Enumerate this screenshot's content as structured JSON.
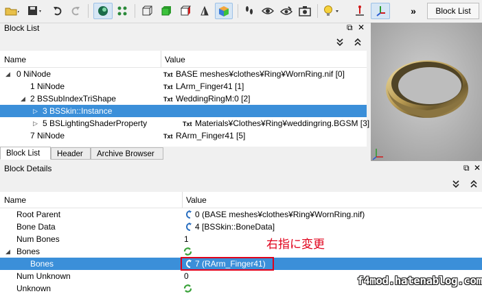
{
  "toolbar": {
    "blocklist_button": "Block List",
    "more_glyph": "»",
    "icons": [
      "open-folder-icon",
      "save-icon",
      "undo-icon",
      "redo-icon",
      "sphere-icon",
      "nodes-icon",
      "wireframe-cube-icon",
      "solid-cube-icon",
      "textured-cube-icon",
      "normals-icon",
      "colored-cube-icon",
      "footprints-icon",
      "eye-icon",
      "eye-dropper-icon",
      "camera-icon",
      "light-bulb-icon",
      "axes-icon",
      "axes-active-icon"
    ]
  },
  "block_list": {
    "title": "Block List",
    "columns": {
      "name": "Name",
      "value": "Value"
    },
    "rows": [
      {
        "name": "0 NiNode",
        "value": "BASE meshes¥clothes¥Ring¥WornRing.nif [0]",
        "txt": "Txt",
        "expander": "◢"
      },
      {
        "name": "1 NiNode",
        "value": "LArm_Finger41 [1]",
        "txt": "Txt",
        "expander": ""
      },
      {
        "name": "2 BSSubIndexTriShape",
        "value": "WeddingRingM:0 [2]",
        "txt": "Txt",
        "expander": "◢"
      },
      {
        "name": "3 BSSkin::Instance",
        "value": "",
        "txt": "",
        "expander": "▷"
      },
      {
        "name": "5 BSLightingShaderProperty",
        "value": "Materials¥Clothes¥Ring¥weddingring.BGSM [3]",
        "txt": "Txt",
        "expander": "▷"
      },
      {
        "name": "7 NiNode",
        "value": "RArm_Finger41 [5]",
        "txt": "Txt",
        "expander": ""
      }
    ],
    "tabs": [
      "Block List",
      "Header",
      "Archive Browser"
    ]
  },
  "block_details": {
    "title": "Block Details",
    "columns": {
      "name": "Name",
      "value": "Value"
    },
    "rows": [
      {
        "name": "Root Parent",
        "value": "0 (BASE meshes¥clothes¥Ring¥WornRing.nif)",
        "icon": "link"
      },
      {
        "name": "Bone Data",
        "value": "4 [BSSkin::BoneData]",
        "icon": "link"
      },
      {
        "name": "Num Bones",
        "value": "1",
        "icon": ""
      },
      {
        "name": "Bones",
        "value": "",
        "icon": "recycle",
        "expander": "◢"
      },
      {
        "name": "Bones",
        "value": "7 (RArm_Finger41)",
        "icon": "link"
      },
      {
        "name": "Num Unknown",
        "value": "0",
        "icon": ""
      },
      {
        "name": "Unknown",
        "value": "",
        "icon": "recycle"
      }
    ],
    "annotation": "右指に変更",
    "watermark": "f4mod.hatenablog.com"
  },
  "dock_buttons": {
    "float": "⧉",
    "close": "✕",
    "collapse": "⌄⌄",
    "expand": "⌃⌃"
  },
  "colors": {
    "selection": "#3b8fd9",
    "annotation": "#e0001a",
    "highlight_box": "#e0001a"
  }
}
